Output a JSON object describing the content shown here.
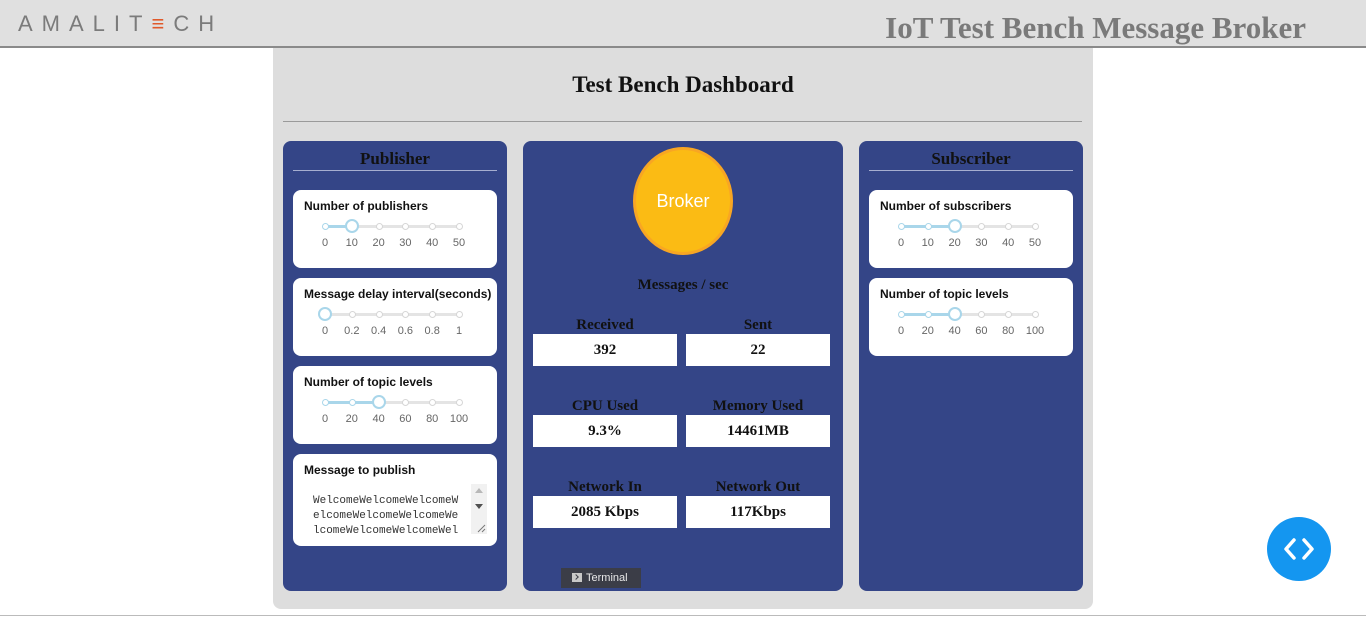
{
  "header": {
    "logo_left": "AMALIT",
    "logo_accent": "☰",
    "logo_right": "CH",
    "title": "IoT Test Bench Message Broker"
  },
  "dashboard": {
    "title": "Test Bench Dashboard"
  },
  "publisher": {
    "heading": "Publisher",
    "publishers": {
      "label": "Number of publishers",
      "ticks": [
        "0",
        "10",
        "20",
        "30",
        "40",
        "50"
      ],
      "value": 10
    },
    "delay": {
      "label": "Message delay interval(seconds)",
      "ticks": [
        "0",
        "0.2",
        "0.4",
        "0.6",
        "0.8",
        "1"
      ],
      "value": 0
    },
    "topic_levels": {
      "label": "Number of topic levels",
      "ticks": [
        "0",
        "20",
        "40",
        "60",
        "80",
        "100"
      ],
      "value": 40
    },
    "message": {
      "label": "Message to publish",
      "value": "WelcomeWelcomeWelcomeWelcomeWelcomeWelcomeWelcomeWelcomeWelcomeWelc"
    }
  },
  "broker": {
    "label": "Broker",
    "messages_heading": "Messages / sec",
    "received_label": "Received",
    "received_value": "392",
    "sent_label": "Sent",
    "sent_value": "22",
    "cpu_label": "CPU Used",
    "cpu_value": "9.3%",
    "memory_label": "Memory Used",
    "memory_value": "14461MB",
    "net_in_label": "Network In",
    "net_in_value": "2085 Kbps",
    "net_out_label": "Network Out",
    "net_out_value": "117Kbps",
    "terminal_label": "Terminal"
  },
  "subscriber": {
    "heading": "Subscriber",
    "subscribers": {
      "label": "Number of subscribers",
      "ticks": [
        "0",
        "10",
        "20",
        "30",
        "40",
        "50"
      ],
      "value": 20
    },
    "topic_levels": {
      "label": "Number of topic levels",
      "ticks": [
        "0",
        "20",
        "40",
        "60",
        "80",
        "100"
      ],
      "value": 40
    }
  },
  "colors": {
    "panel_blue": "#344587",
    "broker_yellow": "#fbbb14",
    "slider_accent": "#a9d6ea",
    "fab_blue": "#1496f0",
    "logo_accent": "#e0592a"
  },
  "icons": {
    "terminal": "terminal-icon",
    "code_toggle": "code-brackets-icon"
  }
}
